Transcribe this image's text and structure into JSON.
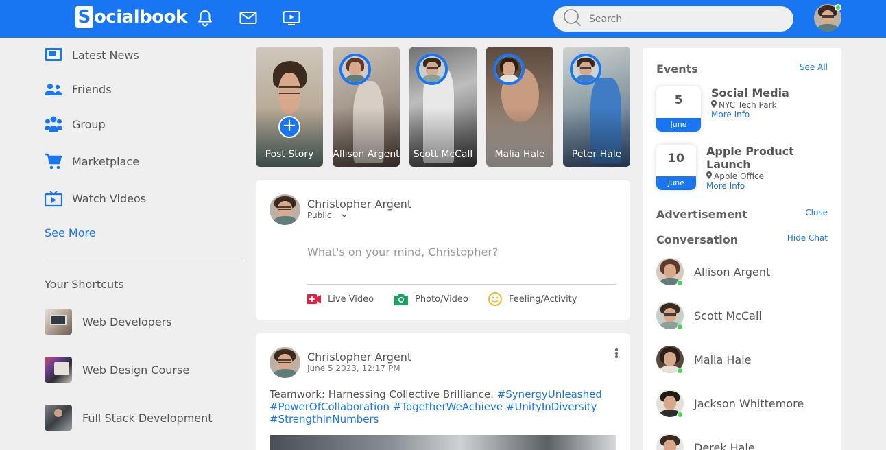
{
  "header": {
    "logo_letter": "S",
    "logo_text": "ocialbook",
    "search_placeholder": "Search",
    "icons": [
      "notification-bell-icon",
      "mail-icon",
      "video-icon",
      "search-icon"
    ]
  },
  "sidebar": {
    "items": [
      {
        "label": "Latest News",
        "icon": "news-icon"
      },
      {
        "label": "Friends",
        "icon": "friends-icon"
      },
      {
        "label": "Group",
        "icon": "group-icon"
      },
      {
        "label": "Marketplace",
        "icon": "cart-icon"
      },
      {
        "label": "Watch Videos",
        "icon": "tv-icon"
      }
    ],
    "see_more": "See More",
    "shortcuts_title": "Your Shortcuts",
    "shortcuts": [
      {
        "label": "Web Developers"
      },
      {
        "label": "Web Design Course"
      },
      {
        "label": "Full Stack Development"
      }
    ]
  },
  "stories": [
    {
      "name": "Post Story"
    },
    {
      "name": "Allison Argent"
    },
    {
      "name": "Scott McCall"
    },
    {
      "name": "Malia Hale"
    },
    {
      "name": "Peter Hale"
    }
  ],
  "composer": {
    "user_name": "Christopher Argent",
    "privacy": "Public",
    "placeholder": "What's on your mind, Christopher?",
    "actions": [
      {
        "label": "Live Video",
        "icon": "live-video-icon"
      },
      {
        "label": "Photo/Video",
        "icon": "camera-icon"
      },
      {
        "label": "Feeling/Activity",
        "icon": "smiley-icon"
      }
    ]
  },
  "post": {
    "user_name": "Christopher Argent",
    "timestamp": "June 5 2023, 12:17 PM",
    "text": "Teamwork: Harnessing Collective Brilliance.",
    "hashtags": [
      "#SynergyUnleashed",
      "#PowerOfCollaboration",
      "#TogetherWeAchieve",
      "#UnityInDiversity",
      "#StrengthInNumbers"
    ]
  },
  "right": {
    "events_title": "Events",
    "see_all": "See All",
    "events": [
      {
        "day": "5",
        "month": "June",
        "title": "Social Media",
        "location": "NYC Tech Park",
        "more": "More Info"
      },
      {
        "day": "10",
        "month": "June",
        "title": "Apple Product Launch",
        "location": "Apple Office",
        "more": "More Info"
      }
    ],
    "ad_title": "Advertisement",
    "ad_close": "Close",
    "conversation_title": "Conversation",
    "hide_chat": "Hide Chat",
    "contacts": [
      {
        "name": "Allison Argent",
        "online": true
      },
      {
        "name": "Scott McCall",
        "online": true
      },
      {
        "name": "Malia Hale",
        "online": true
      },
      {
        "name": "Jackson Whittemore",
        "online": true
      },
      {
        "name": "Derek Hale",
        "online": false
      }
    ]
  },
  "colors": {
    "brand": "#1876f2",
    "online": "#41db51",
    "live": "#e41e3f",
    "photo": "#1aa260",
    "feeling": "#f7b928"
  }
}
